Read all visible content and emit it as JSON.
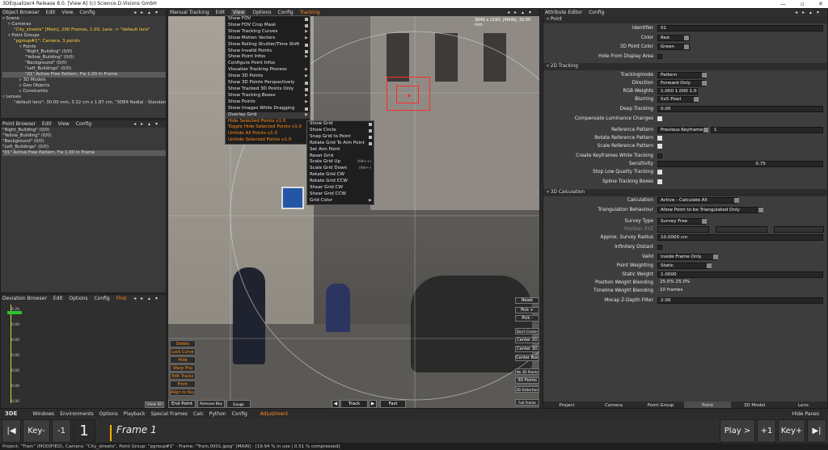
{
  "window": {
    "title": "3DEqualizer4 Release 8.0. [View A]   (c) Science.D.Visions GmbH"
  },
  "object_browser": {
    "menu": [
      "Object Browser",
      "Edit",
      "View",
      "Config"
    ],
    "tree": [
      {
        "text": "▿ Scene",
        "indent": 0,
        "hl": false,
        "sel": false
      },
      {
        "text": "▿ Cameras",
        "indent": 1,
        "hl": false,
        "sel": false
      },
      {
        "text": "\"City_streets\" [Main], 200 Frames, 1.00, Lens -> \"default lens\"",
        "indent": 2,
        "hl": true,
        "sel": false
      },
      {
        "text": "▿ Point Groups",
        "indent": 1,
        "hl": false,
        "sel": false
      },
      {
        "text": "\"pgroup#1\": Camera, 3 points",
        "indent": 2,
        "hl": true,
        "sel": false
      },
      {
        "text": "▿ Points",
        "indent": 3,
        "hl": false,
        "sel": false
      },
      {
        "text": "\"Right_Building\" (0/0)",
        "indent": 4,
        "hl": false,
        "sel": false
      },
      {
        "text": "\"Yellow_Building\" (0/0)",
        "indent": 4,
        "hl": false,
        "sel": false
      },
      {
        "text": "\"Background\" (0/0)",
        "indent": 4,
        "hl": false,
        "sel": false
      },
      {
        "text": "\"Left_Buildings\" (0/0)",
        "indent": 4,
        "hl": false,
        "sel": false
      },
      {
        "text": "\"01\"        Active     Free       Pattern, Fw          1.00       In Frame",
        "indent": 4,
        "hl": false,
        "sel": true
      },
      {
        "text": "▹ 3D Models",
        "indent": 3,
        "hl": false,
        "sel": false
      },
      {
        "text": "▹ Geo Objects",
        "indent": 3,
        "hl": false,
        "sel": false
      },
      {
        "text": "▹ Constraints",
        "indent": 3,
        "hl": false,
        "sel": false
      },
      {
        "text": "▿ Lenses",
        "indent": 0,
        "hl": false,
        "sel": false
      },
      {
        "text": "\"default lens\": 30.00 mm, 3.32 cm x 1.87 cm, \"3DE4 Radial - Standard, D",
        "indent": 2,
        "hl": false,
        "sel": false
      }
    ]
  },
  "point_browser": {
    "menu": [
      "Point Browser",
      "Edit",
      "View",
      "Config"
    ],
    "rows": [
      {
        "text": "\"Right_Building\" (0/0)",
        "sel": false
      },
      {
        "text": "\"Yellow_Building\" (0/0)",
        "sel": false
      },
      {
        "text": "\"Background\" (0/0)",
        "sel": false
      },
      {
        "text": "\"Left_Buildings\" (0/0)",
        "sel": false
      },
      {
        "text": "  \"01\"        Active     Free       Pattern, Fw          1.00       In Frame",
        "sel": true
      }
    ]
  },
  "deviation_browser": {
    "menu": [
      "Deviation Browser",
      "Edit",
      "Options",
      "Config",
      "Find"
    ],
    "yticks": [
      "0.20",
      "0.00",
      "0.00",
      "0.00",
      "0.00",
      "0.00",
      "0.00"
    ],
    "view_all": "View All"
  },
  "viewport": {
    "menu": [
      "Manual Tracking",
      "Edit",
      "View",
      "Options",
      "Config",
      "Tracking"
    ],
    "info": "3840 x 2160, [MAIN], 30.00 mm",
    "view_menu": [
      {
        "t": "Show FOV",
        "k": "sq",
        "o": false
      },
      {
        "t": "Show FOV Crop Mask",
        "k": "sq",
        "o": false
      },
      {
        "t": "Show Tracking Curves",
        "k": "tri",
        "o": false
      },
      {
        "t": "Show Motion Vectors",
        "k": "tri",
        "o": false
      },
      {
        "t": "Show Rolling Shutter/Time Shift",
        "k": "sq",
        "o": false
      },
      {
        "t": "Show Invalid Points",
        "k": "sq",
        "o": false
      },
      {
        "t": "Show Point Infos",
        "k": "tri",
        "o": false
      },
      {
        "t": "Configure Point Infos",
        "k": "",
        "o": false
      },
      {
        "t": "Visualize Tracking Process",
        "k": "tri",
        "o": false
      },
      {
        "t": "Show 3D Points",
        "k": "tri",
        "o": false
      },
      {
        "t": "Show 3D Points Perspectively",
        "k": "sq",
        "o": false
      },
      {
        "t": "Show Tracked 3D Points Only",
        "k": "sq",
        "o": false
      },
      {
        "t": "Show Tracking Boxes",
        "k": "tri",
        "o": false
      },
      {
        "t": "Show Points",
        "k": "tri",
        "o": false
      },
      {
        "t": "Show Images While Dragging",
        "k": "sq",
        "o": false
      },
      {
        "t": "Overlay Grid",
        "k": "tri",
        "o": false
      },
      {
        "t": "Hide Selected Points v1.0",
        "k": "",
        "o": true
      },
      {
        "t": "Toggle Hide Selected Points v1.0",
        "k": "",
        "o": true
      },
      {
        "t": "Unhide All Points v1.0",
        "k": "",
        "o": true
      },
      {
        "t": "Unhide Selected Points v1.0",
        "k": "",
        "o": true
      }
    ],
    "grid_menu": [
      {
        "t": "Show Grid",
        "k": "sq"
      },
      {
        "t": "Show Circle",
        "k": "sq"
      },
      {
        "t": "Snap Grid to Point",
        "k": "sq"
      },
      {
        "t": "Rotate Grid To Aim Point",
        "k": "sq"
      },
      {
        "t": "Set Aim Point",
        "k": ""
      },
      {
        "t": "Reset Grid",
        "k": ""
      },
      {
        "t": "Scale Grid Up",
        "k": "(Alt++)"
      },
      {
        "t": "Scale Grid Down",
        "k": "(Alt+-)"
      },
      {
        "t": "Rotate Grid CW",
        "k": ""
      },
      {
        "t": "Rotate Grid CCW",
        "k": ""
      },
      {
        "t": "Shear Grid CW",
        "k": ""
      },
      {
        "t": "Shear Grid CCW",
        "k": ""
      },
      {
        "t": "Grid Color",
        "k": "tri"
      }
    ],
    "left_buttons": [
      "Delete Track",
      "Lock Curve",
      "Hide",
      "Warp Proj UV",
      "Edit Tracks",
      "From Default",
      "Align to Key"
    ],
    "right_buttons": [
      "Reset",
      "Pick +",
      "Pick -",
      "Don't Center",
      "Center 2D",
      "Center 3D",
      "Center Box",
      "No 3D Points",
      "3D Points",
      "3D Distortion",
      "Full Frame"
    ],
    "bottom": {
      "end_point": "End Point",
      "remove_key": "Remove Key",
      "gauge_marker": "Gauge Marker",
      "prev": "◀",
      "track": "Track",
      "next": "▶",
      "fast": "Fast"
    }
  },
  "attribute_editor": {
    "menu": [
      "Attribute Editor",
      "Config"
    ],
    "sections": {
      "point": "▿ Point",
      "tracking": "▿ 2D Tracking",
      "calc": "▿ 3D Calculation"
    },
    "fields": {
      "identifier_l": "Identifier",
      "identifier": "01",
      "color_l": "Color",
      "color": "Red",
      "pcolor_l": "3D Point Color",
      "pcolor": "Green",
      "hide_l": "Hide From Display Area",
      "trackmode_l": "Trackingmode",
      "trackmode": "Pattern",
      "direction_l": "Direction",
      "direction": "Forward Only",
      "rgb_l": "RGB Weights",
      "rgb": "1.000 1.000 1.000",
      "blur_l": "Blurring",
      "blur": "5x5 Pixel",
      "deep_l": "Deep Tracking",
      "deep": "0.00",
      "comp_l": "Compensate Luminance Changes",
      "refpat_l": "Reference Pattern",
      "refpat": "Previous Keyframe",
      "refpat2": "1",
      "rotref_l": "Rotate Reference Pattern",
      "scaleref_l": "Scale Reference Pattern",
      "createkf_l": "Create Keyframes While Tracking",
      "sens_l": "Sensitivity",
      "sens": "0.75",
      "stoplow_l": "Stop Low Quality Tracking",
      "spline_l": "Spline Tracking Boxes",
      "calc_l": "Calculation",
      "calc": "Active - Calculate All",
      "tri_l": "Triangulation Behaviour",
      "tri": "Allow Point to be Triangulated Only",
      "survey_l": "Survey Type",
      "survey": "Survey Free",
      "posxyz_l": "Position XYZ",
      "approx_l": "Approx. Survey Radius",
      "approx": "10.0000 cm",
      "infdist_l": "Infinitely Distant",
      "valid_l": "Valid",
      "valid": "Inside Frame Only",
      "pweight_l": "Point Weighting",
      "pweight": "Static",
      "sweight_l": "Static Weight",
      "sweight": "1.0000",
      "posblend_l": "Position Weight Blending",
      "posblend": "25.0%  25.0%",
      "tlblend_l": "Timeline Weight Blending",
      "tlblend": "10 frames",
      "mocap_l": "Mocap Z-Depth Filter",
      "mocap": "2.00"
    },
    "tabs": [
      "Project",
      "Camera",
      "Point Group",
      "Point",
      "3D Model",
      "Lens"
    ]
  },
  "main_menu": {
    "logo": "3DE",
    "items": [
      "Windows",
      "Environments",
      "Options",
      "Playback",
      "Special Frames",
      "Calc",
      "Python",
      "Config"
    ],
    "hot": "Adjustment",
    "hide_panes": "Hide Panes"
  },
  "timeline": {
    "first": "|◀",
    "keyminus": "Key-",
    "minus1": "-1",
    "frame_num": "1",
    "frame_label": "Frame 1",
    "play": "Play >",
    "plus1": "+1",
    "keyplus": "Key+",
    "last": "▶|"
  },
  "status": "Project: \"Tram\" (MODIFIED), Camera: \"City_streets\", Point Group: \"pgroup#1\" - Frame: \"Tram.0001.jpeg\" [MAIN] - [19.94 % in use | 0.51 % compressed]",
  "colors": {
    "accent": "#ff8c1a",
    "highlight": "#ffd23a",
    "tracker": "#ff2a2a"
  }
}
